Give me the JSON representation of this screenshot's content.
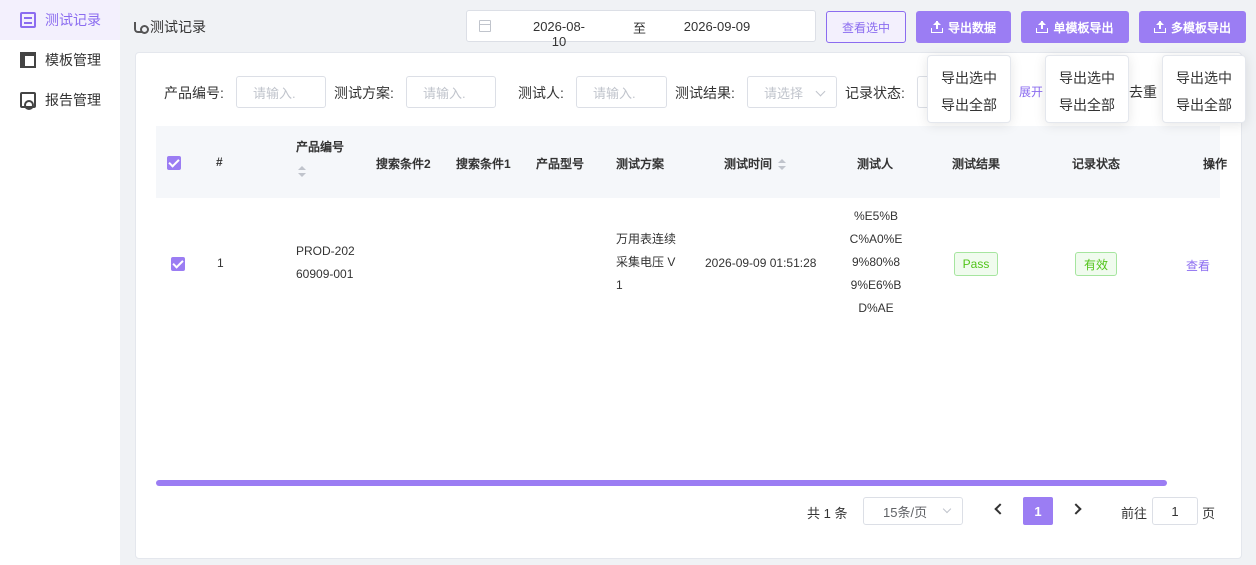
{
  "sidebar": {
    "items": [
      {
        "label": "测试记录",
        "icon": "document-icon",
        "active": true
      },
      {
        "label": "模板管理",
        "icon": "table-icon",
        "active": false
      },
      {
        "label": "报告管理",
        "icon": "report-icon",
        "active": false
      }
    ]
  },
  "header": {
    "breadcrumb": "测试记录",
    "date_start": "2026-08-10",
    "date_separator": "至",
    "date_end": "2026-09-09",
    "view_selected_label": "查看选中",
    "export_data_label": "导出数据",
    "single_template_export_label": "单模板导出",
    "multi_template_export_label": "多模板导出"
  },
  "dropdowns": [
    {
      "items": [
        "导出选中",
        "导出全部"
      ]
    },
    {
      "items": [
        "导出选中",
        "导出全部"
      ]
    },
    {
      "items": [
        "导出选中",
        "导出全部"
      ]
    }
  ],
  "filters": {
    "product_no_label": "产品编号:",
    "product_no_placeholder": "请输入.",
    "test_plan_label": "测试方案:",
    "test_plan_placeholder": "请输入.",
    "tester_label": "测试人:",
    "tester_placeholder": "请输入.",
    "test_result_label": "测试结果:",
    "test_result_placeholder": "请选择",
    "record_status_label": "记录状态:",
    "expand_label": "展开",
    "dedup_label": "去重"
  },
  "table": {
    "columns": {
      "index": "#",
      "product_no": "产品编号",
      "search2": "搜索条件2",
      "search1": "搜索条件1",
      "model": "产品型号",
      "plan": "测试方案",
      "time": "测试时间",
      "tester": "测试人",
      "result": "测试结果",
      "status": "记录状态",
      "action": "操作"
    },
    "rows": [
      {
        "index": "1",
        "product_no_line1": "PROD-202",
        "product_no_line2": "60909-001",
        "search2": "",
        "search1": "",
        "model": "",
        "plan_line1": "万用表连续",
        "plan_line2": "采集电压 V",
        "plan_line3": "1",
        "time": "2026-09-09 01:51:28",
        "tester_line1": "%E5%B",
        "tester_line2": "C%A0%E",
        "tester_line3": "9%80%8",
        "tester_line4": "9%E6%B",
        "tester_line5": "D%AE",
        "result": "Pass",
        "status": "有效",
        "action": "查看",
        "selected": true
      }
    ]
  },
  "pagination": {
    "total": "共 1 条",
    "page_size": "15条/页",
    "current_page": "1",
    "goto_label": "前往",
    "goto_value": "1",
    "goto_unit": "页"
  },
  "colors": {
    "accent": "#9b7df3",
    "accent_text": "#8b6cf0",
    "success": "#52c41a"
  }
}
